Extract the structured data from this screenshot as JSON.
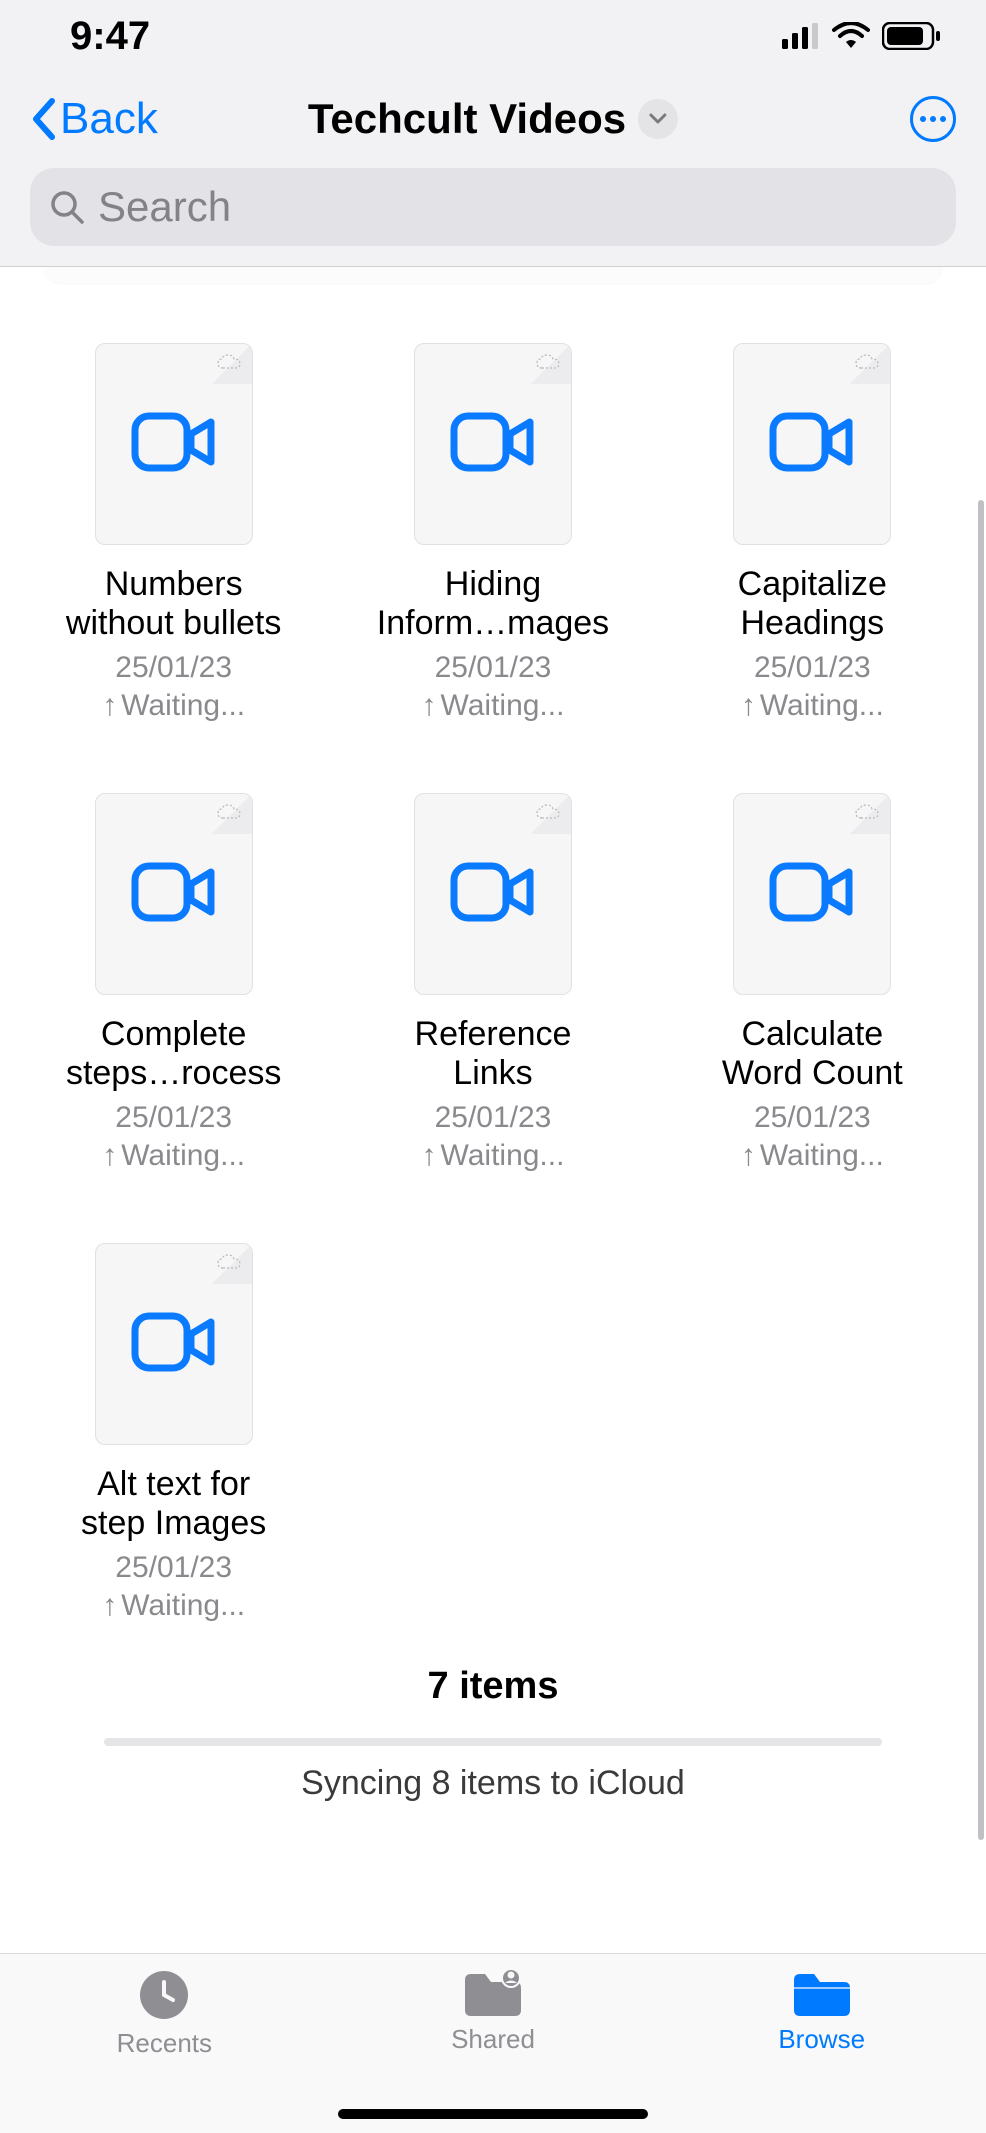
{
  "status": {
    "time": "9:47"
  },
  "nav": {
    "back_label": "Back",
    "title": "Techcult Videos"
  },
  "search": {
    "placeholder": "Search"
  },
  "files": [
    {
      "line1": "Numbers",
      "line2": "without bullets",
      "date": "25/01/23",
      "status": "Waiting..."
    },
    {
      "line1": "Hiding",
      "line2": "Inform…mages",
      "date": "25/01/23",
      "status": "Waiting..."
    },
    {
      "line1": "Capitalize",
      "line2": "Headings",
      "date": "25/01/23",
      "status": "Waiting..."
    },
    {
      "line1": "Complete",
      "line2": "steps…rocess",
      "date": "25/01/23",
      "status": "Waiting..."
    },
    {
      "line1": "Reference",
      "line2": "Links",
      "date": "25/01/23",
      "status": "Waiting..."
    },
    {
      "line1": "Calculate",
      "line2": "Word Count",
      "date": "25/01/23",
      "status": "Waiting..."
    },
    {
      "line1": "Alt text for",
      "line2": "step Images",
      "date": "25/01/23",
      "status": "Waiting..."
    }
  ],
  "footer": {
    "count": "7 items",
    "sync": "Syncing 8 items to iCloud"
  },
  "tabs": {
    "recents": "Recents",
    "shared": "Shared",
    "browse": "Browse"
  }
}
